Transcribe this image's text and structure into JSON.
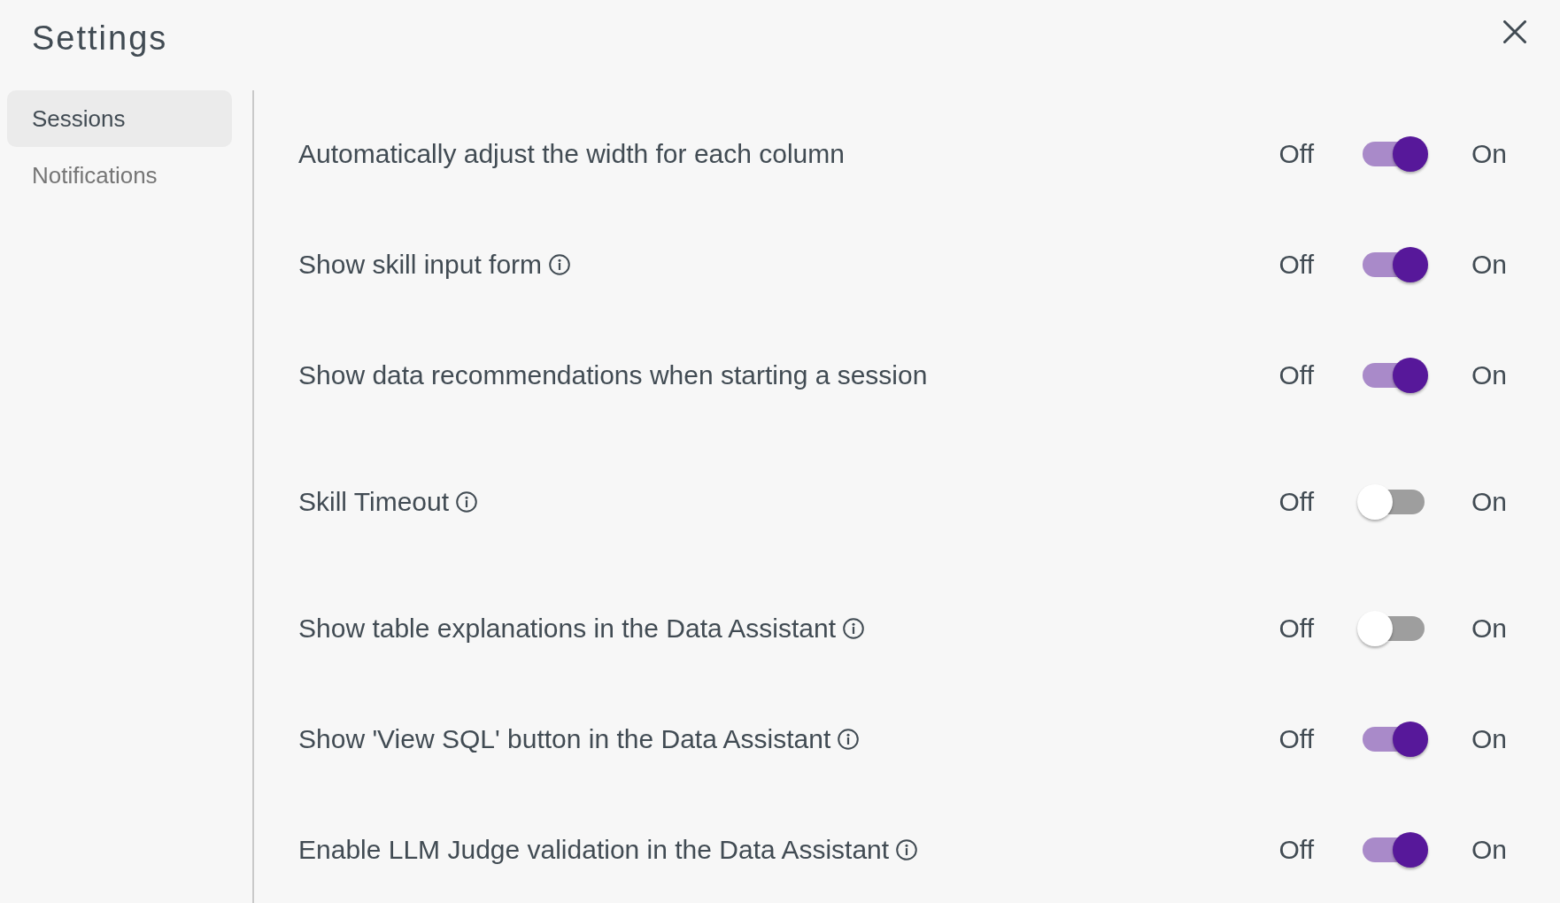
{
  "dialog": {
    "title": "Settings"
  },
  "sidebar": {
    "items": [
      {
        "label": "Sessions",
        "selected": true
      },
      {
        "label": "Notifications",
        "selected": false
      }
    ]
  },
  "settings": [
    {
      "label": "Automatically adjust the width for each column",
      "has_info": false,
      "off_label": "Off",
      "on_label": "On",
      "on": true
    },
    {
      "label": "Show skill input form",
      "has_info": true,
      "off_label": "Off",
      "on_label": "On",
      "on": true
    },
    {
      "label": "Show data recommendations when starting a session",
      "has_info": false,
      "off_label": "Off",
      "on_label": "On",
      "on": true
    },
    {
      "label": "Skill Timeout",
      "has_info": true,
      "off_label": "Off",
      "on_label": "On",
      "on": false
    },
    {
      "label": "Show table explanations in the Data Assistant",
      "has_info": true,
      "off_label": "Off",
      "on_label": "On",
      "on": false
    },
    {
      "label": "Show 'View SQL' button in the Data Assistant",
      "has_info": true,
      "off_label": "Off",
      "on_label": "On",
      "on": true
    },
    {
      "label": "Enable LLM Judge validation in the Data Assistant",
      "has_info": true,
      "off_label": "Off",
      "on_label": "On",
      "on": true
    }
  ]
}
